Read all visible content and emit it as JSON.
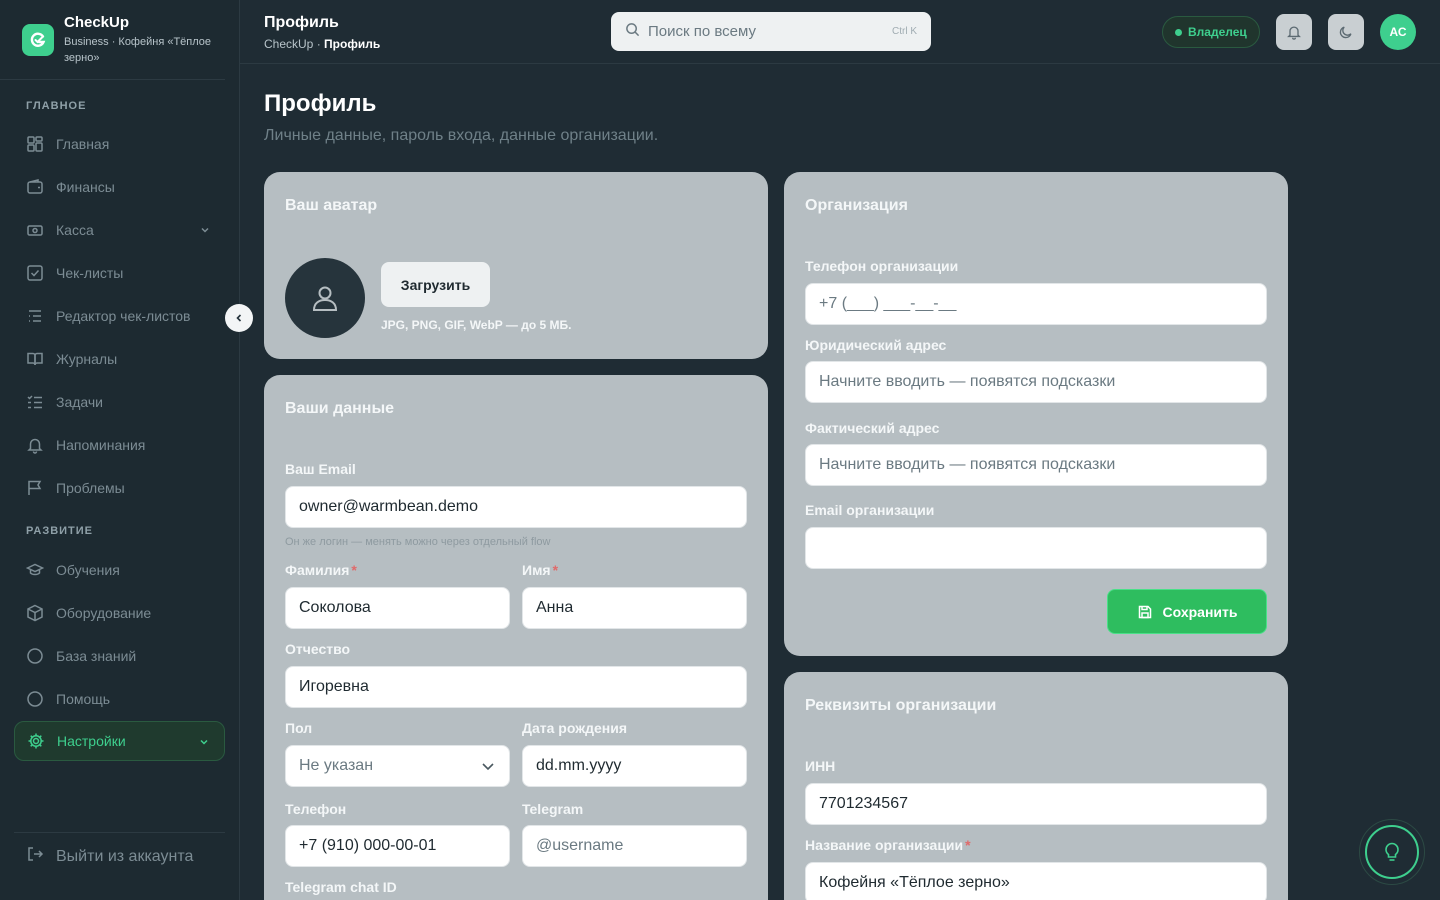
{
  "brand": {
    "name": "CheckUp",
    "subtitle": "Business · Кофейня «Тёплое зерно»"
  },
  "sidebar": {
    "section_main": "ГЛАВНОЕ",
    "section_growth": "РАЗВИТИЕ",
    "items": [
      {
        "label": "Главная",
        "icon": "dashboard-icon"
      },
      {
        "label": "Финансы",
        "icon": "wallet-icon"
      },
      {
        "label": "Касса",
        "icon": "cash-register-icon"
      },
      {
        "label": "Чек-листы",
        "icon": "checklist-icon"
      },
      {
        "label": "Редактор чек-листов",
        "icon": "list-edit-icon"
      },
      {
        "label": "Журналы",
        "icon": "book-icon"
      },
      {
        "label": "Задачи",
        "icon": "tasks-icon"
      },
      {
        "label": "Напоминания",
        "icon": "bell-icon"
      },
      {
        "label": "Проблемы",
        "icon": "flag-icon"
      },
      {
        "label": "Обучения",
        "icon": "graduation-cap-icon"
      },
      {
        "label": "Оборудование",
        "icon": "box-icon"
      },
      {
        "label": "База знаний",
        "icon": "circle-icon"
      },
      {
        "label": "Помощь",
        "icon": "circle-icon"
      },
      {
        "label": "Настройки",
        "icon": "gear-icon"
      }
    ],
    "logout": "Выйти из аккаунта"
  },
  "header": {
    "title": "Профиль",
    "crumb_root": "CheckUp",
    "crumb_sep": " · ",
    "crumb_current": "Профиль",
    "search_placeholder": "Поиск по всему",
    "search_shortcut": "Ctrl K",
    "role_badge": "Владелец",
    "avatar_initials": "АС"
  },
  "page": {
    "title": "Профиль",
    "subtitle": "Личные данные, пароль входа, данные организации."
  },
  "avatar_card": {
    "title": "Ваш аватар",
    "upload_label": "Загрузить",
    "hint": "JPG, PNG, GIF, WebP — до 5 МБ."
  },
  "personal_card": {
    "title": "Ваши данные",
    "email_label": "Ваш Email",
    "email_value": "owner@warmbean.demo",
    "email_hint": "Он же логин — менять можно через отдельный flow",
    "last_name_label": "Фамилия",
    "last_name_value": "Соколова",
    "first_name_label": "Имя",
    "first_name_value": "Анна",
    "middle_name_label": "Отчество",
    "middle_name_value": "Игоревна",
    "gender_label": "Пол",
    "gender_value": "Не указан",
    "birthdate_label": "Дата рождения",
    "birthdate_value": "dd.mm.yyyy",
    "phone_label": "Телефон",
    "phone_value": "+7 (910) 000-00-01",
    "telegram_label": "Telegram",
    "telegram_placeholder": "@username",
    "telegram_chat_label": "Telegram chat ID",
    "required_mark": "*"
  },
  "org_card": {
    "title": "Организация",
    "phone_label": "Телефон организации",
    "phone_placeholder": "+7 (___) ___-__-__",
    "legal_address_label": "Юридический адрес",
    "legal_address_placeholder": "Начните вводить — появятся подсказки",
    "actual_address_label": "Фактический адрес",
    "actual_address_placeholder": "Начните вводить — появятся подсказки",
    "email_label": "Email организации",
    "email_value": "",
    "save_label": "Сохранить"
  },
  "requisites_card": {
    "title": "Реквизиты организации",
    "inn_label": "ИНН",
    "inn_value": "7701234567",
    "org_name_label": "Название организации",
    "org_name_value": "Кофейня «Тёплое зерно»",
    "required_mark": "*"
  },
  "colors": {
    "accent": "#3ecf8e",
    "save_button": "#2ebd5f",
    "background": "#1f2c34",
    "card": "#b6bec2"
  }
}
